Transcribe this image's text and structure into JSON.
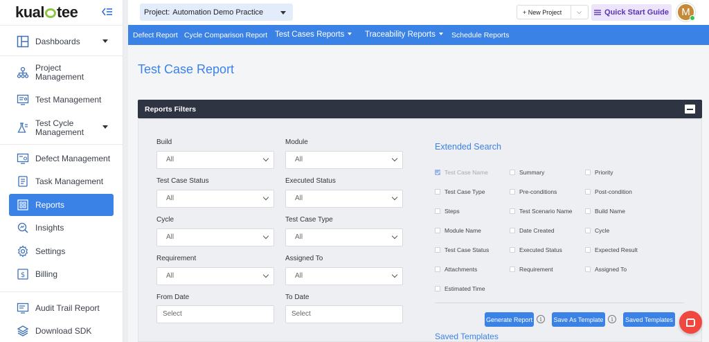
{
  "brand": {
    "logo_left": "kual",
    "logo_right": "tee"
  },
  "sidebar": {
    "items": [
      {
        "label": "Dashboards",
        "icon": "dashboard-icon",
        "caret": true
      },
      {
        "label": "Project\nManagement",
        "icon": "org-chart-icon"
      },
      {
        "label": "Test Management",
        "icon": "test-management-icon"
      },
      {
        "label": "Test Cycle\nManagement",
        "icon": "flask-icon",
        "caret": true
      },
      {
        "label": "Defect Management",
        "icon": "bug-icon"
      },
      {
        "label": "Task Management",
        "icon": "task-icon"
      },
      {
        "label": "Reports",
        "icon": "reports-icon",
        "active": true
      },
      {
        "label": "Insights",
        "icon": "insights-icon"
      },
      {
        "label": "Settings",
        "icon": "gear-icon"
      },
      {
        "label": "Billing",
        "icon": "billing-icon"
      },
      {
        "label": "Audit Trail Report",
        "icon": "audit-icon"
      },
      {
        "label": "Download SDK",
        "icon": "layers-icon"
      }
    ]
  },
  "topbar": {
    "project_label": "Project:",
    "project_value": "Automation Demo Practice",
    "new_project": "+  New Project",
    "quick_start": "Quick Start Guide",
    "avatar_initial": "M"
  },
  "report_nav": {
    "items": [
      "Defect Report",
      "Cycle Comparison Report",
      "Test Cases Reports",
      "Traceability Reports",
      "Schedule Reports"
    ]
  },
  "page": {
    "title": "Test Case Report",
    "filters_title": "Reports Filters"
  },
  "filters": {
    "build": {
      "label": "Build",
      "value": "All"
    },
    "module": {
      "label": "Module",
      "value": "All"
    },
    "test_case_status": {
      "label": "Test Case Status",
      "value": "All"
    },
    "executed_status": {
      "label": "Executed Status",
      "value": "All"
    },
    "cycle": {
      "label": "Cycle",
      "value": "All"
    },
    "test_case_type": {
      "label": "Test Case Type",
      "value": "All"
    },
    "requirement": {
      "label": "Requirement",
      "value": "All"
    },
    "assigned_to": {
      "label": "Assigned To",
      "value": "All"
    },
    "from_date": {
      "label": "From Date",
      "placeholder": "Select"
    },
    "to_date": {
      "label": "To Date",
      "placeholder": "Select"
    }
  },
  "extended_search": {
    "title": "Extended Search",
    "options": [
      {
        "label": "Test Case Name",
        "checked": true
      },
      {
        "label": "Summary",
        "checked": false
      },
      {
        "label": "Priority",
        "checked": false
      },
      {
        "label": "Test Case Type",
        "checked": false
      },
      {
        "label": "Pre-conditions",
        "checked": false
      },
      {
        "label": "Post-condition",
        "checked": false
      },
      {
        "label": "Steps",
        "checked": false
      },
      {
        "label": "Test Scenario Name",
        "checked": false
      },
      {
        "label": "Build Name",
        "checked": false
      },
      {
        "label": "Module Name",
        "checked": false
      },
      {
        "label": "Date Created",
        "checked": false
      },
      {
        "label": "Cycle",
        "checked": false
      },
      {
        "label": "Test Case Status",
        "checked": false
      },
      {
        "label": "Executed Status",
        "checked": false
      },
      {
        "label": "Expected Result",
        "checked": false
      },
      {
        "label": "Attachments",
        "checked": false
      },
      {
        "label": "Requirement",
        "checked": false
      },
      {
        "label": "Assigned To",
        "checked": false
      },
      {
        "label": "Estimated Time",
        "checked": false
      }
    ]
  },
  "actions": {
    "generate": "Generate Report",
    "save_template": "Save As Template",
    "saved_templates": "Saved Templates",
    "info": "i"
  },
  "saved_templates_title": "Saved Templates",
  "colors": {
    "accent": "#3b82e6",
    "dark_bar": "#2e3442",
    "chat": "#f0483e"
  }
}
